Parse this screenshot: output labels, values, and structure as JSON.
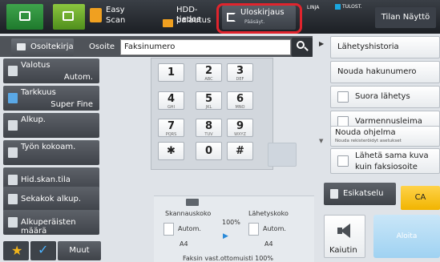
{
  "topbar": {
    "easy_scan_label_1": "Easy",
    "easy_scan_label_2": "Scan",
    "hdd_label_1": "HDD-tiedos",
    "hdd_label_2": "palautus",
    "logout_label": "Uloskirjaus",
    "logout_sub": "Pääsäyt.",
    "linja_label": "LINJA",
    "tulost_label": "TULOST.",
    "status_button": "Tilan Näyttö"
  },
  "address": {
    "book_label": "Osoitekirja",
    "address_label": "Osoite",
    "fax_input_value": "Faksinumero"
  },
  "left_menu": {
    "valotus_label": "Valotus",
    "valotus_value": "Autom.",
    "tarkkuus_label": "Tarkkuus",
    "tarkkuus_value": "Super Fine",
    "alkup_label": "Alkup.",
    "tyon_kokoam_label": "Työn kokoam.",
    "hid_skan_label": "Hid.skan.tila",
    "sekakok_label": "Sekakok alkup.",
    "alkuperaisten_label": "Alkuperäisten määrä",
    "muut_label": "Muut"
  },
  "keypad": {
    "keys": [
      {
        "main": "1",
        "sub": ""
      },
      {
        "main": "2",
        "sub": "ABC"
      },
      {
        "main": "3",
        "sub": "DEF"
      },
      {
        "main": "4",
        "sub": "GHI"
      },
      {
        "main": "5",
        "sub": "JKL"
      },
      {
        "main": "6",
        "sub": "MNO"
      },
      {
        "main": "7",
        "sub": "PQRS"
      },
      {
        "main": "8",
        "sub": "TUV"
      },
      {
        "main": "9",
        "sub": "WXYZ"
      },
      {
        "main": "✱",
        "sub": ""
      },
      {
        "main": "0",
        "sub": ""
      },
      {
        "main": "#",
        "sub": ""
      }
    ]
  },
  "settings": {
    "skannauskoko_label": "Skannauskoko",
    "lahetyskoko_label": "Lähetyskoko",
    "scan_auto": "Autom.",
    "send_auto": "Autom.",
    "ratio": "100%",
    "scan_paper": "A4",
    "send_paper": "A4",
    "memory_status": "Faksin vast.ottomuisti  100%"
  },
  "right_menu": {
    "lahetyshistoria": "Lähetyshistoria",
    "nouda_hakunumero": "Nouda hakunumero",
    "suora_lahetys": "Suora lähetys",
    "varmennusleima": "Varmennusleima",
    "nouda_ohjelma": "Nouda ohjelma",
    "nouda_ohjelma_sub": "Nouda rekisteröidyt asetukset",
    "laheta_sama_1": "Lähetä sama kuva",
    "laheta_sama_2": "kuin faksiosoite",
    "esikatselu": "Esikatselu",
    "ca": "CA",
    "kaiutin": "Kaiutin",
    "aloita": "Aloita"
  }
}
